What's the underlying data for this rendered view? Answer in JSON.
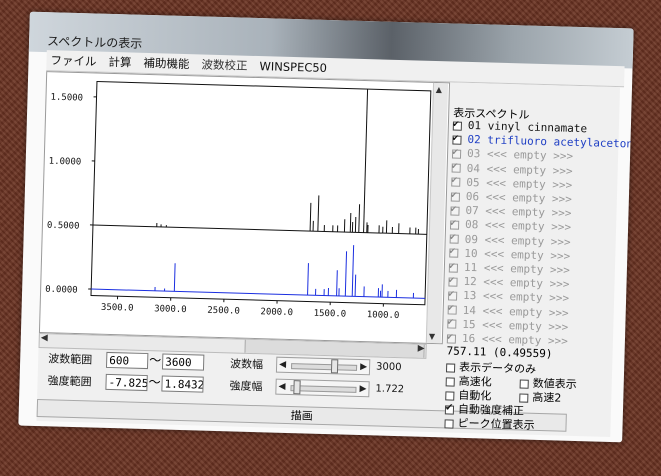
{
  "window": {
    "title": "スペクトルの表示"
  },
  "menu": [
    "ファイル",
    "計算",
    "補助機能",
    "波数校正",
    "WINSPEC50"
  ],
  "chart_data": {
    "type": "line",
    "xlabel": "",
    "ylabel": "",
    "x_ticks": [
      "3500.0",
      "3000.0",
      "2500.0",
      "2000.0",
      "1500.0",
      "1000.0"
    ],
    "y_ticks": [
      "1.5000",
      "1.0000",
      "0.5000",
      "0.0000"
    ],
    "x_range": [
      3750,
      610
    ],
    "series": [
      {
        "color": "#111111",
        "baseline": 0.5,
        "peaks": [
          {
            "x": 3150,
            "y": 0.03
          },
          {
            "x": 3110,
            "y": 0.02
          },
          {
            "x": 3060,
            "y": 0.015
          },
          {
            "x": 1708,
            "y": 0.22
          },
          {
            "x": 1680,
            "y": 0.08
          },
          {
            "x": 1635,
            "y": 0.28
          },
          {
            "x": 1575,
            "y": 0.05
          },
          {
            "x": 1495,
            "y": 0.05
          },
          {
            "x": 1450,
            "y": 0.05
          },
          {
            "x": 1385,
            "y": 0.1
          },
          {
            "x": 1330,
            "y": 0.15
          },
          {
            "x": 1310,
            "y": 0.08
          },
          {
            "x": 1282,
            "y": 0.12
          },
          {
            "x": 1250,
            "y": 0.22
          },
          {
            "x": 1205,
            "y": 1.12
          },
          {
            "x": 1175,
            "y": 0.08
          },
          {
            "x": 1165,
            "y": 0.06
          },
          {
            "x": 1060,
            "y": 0.06
          },
          {
            "x": 1025,
            "y": 0.05
          },
          {
            "x": 990,
            "y": 0.1
          },
          {
            "x": 935,
            "y": 0.05
          },
          {
            "x": 875,
            "y": 0.08
          },
          {
            "x": 770,
            "y": 0.05
          },
          {
            "x": 715,
            "y": 0.05
          },
          {
            "x": 690,
            "y": 0.04
          }
        ]
      },
      {
        "color": "#1a2ee0",
        "baseline": 0.0,
        "peaks": [
          {
            "x": 3150,
            "y": 0.03
          },
          {
            "x": 3060,
            "y": 0.02
          },
          {
            "x": 2968,
            "y": 0.22
          },
          {
            "x": 1715,
            "y": 0.25
          },
          {
            "x": 1640,
            "y": 0.05
          },
          {
            "x": 1560,
            "y": 0.05
          },
          {
            "x": 1520,
            "y": 0.06
          },
          {
            "x": 1442,
            "y": 0.2
          },
          {
            "x": 1420,
            "y": 0.06
          },
          {
            "x": 1360,
            "y": 0.35
          },
          {
            "x": 1295,
            "y": 0.4
          },
          {
            "x": 1268,
            "y": 0.17
          },
          {
            "x": 1185,
            "y": 0.08
          },
          {
            "x": 1050,
            "y": 0.07
          },
          {
            "x": 1030,
            "y": 0.05
          },
          {
            "x": 1015,
            "y": 0.1
          },
          {
            "x": 960,
            "y": 0.05
          },
          {
            "x": 880,
            "y": 0.06
          },
          {
            "x": 720,
            "y": 0.04
          }
        ]
      }
    ],
    "ylim": [
      -0.05,
      1.62
    ]
  },
  "controls": {
    "wavenumber_range_label": "波数範囲",
    "wavenumber_from": "600",
    "wavenumber_to": "3600",
    "intensity_range_label": "強度範囲",
    "intensity_from": "-7.825",
    "intensity_to": "1.8432",
    "tilde": "～",
    "wavenumber_width_label": "波数幅",
    "wavenumber_width_value": "3000",
    "wavenumber_width_level": 0.7,
    "intensity_width_label": "強度幅",
    "intensity_width_value": "1.722",
    "intensity_width_level": 0.05,
    "draw_button": "描画"
  },
  "spectra_panel": {
    "title": "表示スペクトル",
    "items": [
      {
        "no": "01",
        "name": "vinyl cinnamate",
        "checked": true,
        "enabled": true
      },
      {
        "no": "02",
        "name": "trifluoro acetylacetone-enol(E) CCC",
        "checked": true,
        "enabled": true
      },
      {
        "no": "03",
        "name": "<<< empty >>>",
        "checked": true,
        "enabled": false
      },
      {
        "no": "04",
        "name": "<<< empty >>>",
        "checked": true,
        "enabled": false
      },
      {
        "no": "05",
        "name": "<<< empty >>>",
        "checked": true,
        "enabled": false
      },
      {
        "no": "06",
        "name": "<<< empty >>>",
        "checked": true,
        "enabled": false
      },
      {
        "no": "07",
        "name": "<<< empty >>>",
        "checked": true,
        "enabled": false
      },
      {
        "no": "08",
        "name": "<<< empty >>>",
        "checked": true,
        "enabled": false
      },
      {
        "no": "09",
        "name": "<<< empty >>>",
        "checked": true,
        "enabled": false
      },
      {
        "no": "10",
        "name": "<<< empty >>>",
        "checked": true,
        "enabled": false
      },
      {
        "no": "11",
        "name": "<<< empty >>>",
        "checked": true,
        "enabled": false
      },
      {
        "no": "12",
        "name": "<<< empty >>>",
        "checked": true,
        "enabled": false
      },
      {
        "no": "13",
        "name": "<<< empty >>>",
        "checked": true,
        "enabled": false
      },
      {
        "no": "14",
        "name": "<<< empty >>>",
        "checked": true,
        "enabled": false
      },
      {
        "no": "15",
        "name": "<<< empty >>>",
        "checked": true,
        "enabled": false
      },
      {
        "no": "16",
        "name": "<<< empty >>>",
        "checked": true,
        "enabled": false
      }
    ]
  },
  "cursor_readout": "757.11 (0.49559)",
  "options": [
    {
      "label": "表示データのみ",
      "checked": false
    },
    {
      "label": "高速化",
      "checked": false
    },
    {
      "label": "数値表示",
      "checked": false
    },
    {
      "label": "自動化",
      "checked": false
    },
    {
      "label": "高速2",
      "checked": false
    },
    {
      "label": "自動強度補正",
      "checked": true
    },
    {
      "label": "ピーク位置表示",
      "checked": false
    }
  ]
}
